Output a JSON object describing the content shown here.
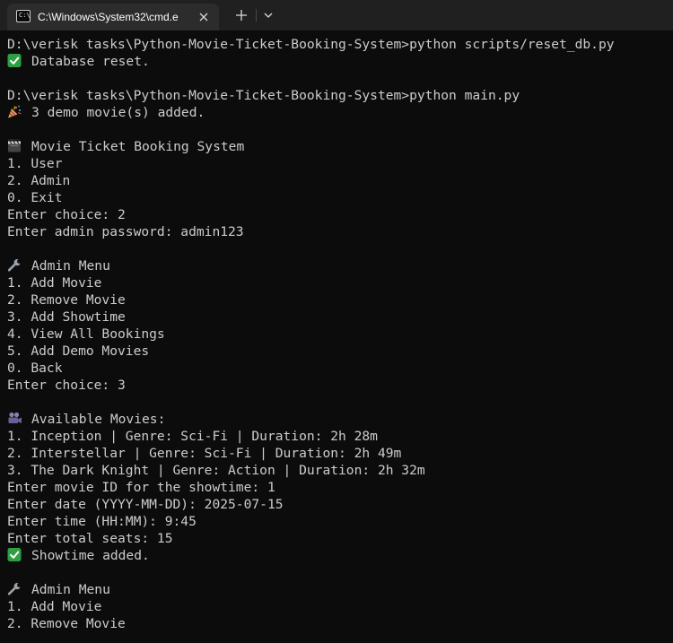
{
  "window": {
    "tab_title": "C:\\Windows\\System32\\cmd.e",
    "tab_icon": "cmd-prompt-icon",
    "new_tab_icon": "plus-icon",
    "dropdown_icon": "chevron-down-icon",
    "close_icon": "close-icon"
  },
  "colors": {
    "background": "#0c0c0c",
    "text": "#cccccc",
    "titlebar": "#202020",
    "tab": "#2c2c2c",
    "check_green": "#2ea043"
  },
  "terminal": {
    "lines": [
      {
        "text": "D:\\verisk tasks\\Python-Movie-Ticket-Booking-System>python scripts/reset_db.py"
      },
      {
        "icon": "check-mark-icon",
        "text": "Database reset."
      },
      {
        "text": ""
      },
      {
        "text": "D:\\verisk tasks\\Python-Movie-Ticket-Booking-System>python main.py"
      },
      {
        "icon": "party-popper-icon",
        "text": "3 demo movie(s) added."
      },
      {
        "text": ""
      },
      {
        "icon": "clapperboard-icon",
        "text": "Movie Ticket Booking System"
      },
      {
        "text": "1. User"
      },
      {
        "text": "2. Admin"
      },
      {
        "text": "0. Exit"
      },
      {
        "text": "Enter choice: 2"
      },
      {
        "text": "Enter admin password: admin123"
      },
      {
        "text": ""
      },
      {
        "icon": "wrench-icon",
        "text": "Admin Menu"
      },
      {
        "text": "1. Add Movie"
      },
      {
        "text": "2. Remove Movie"
      },
      {
        "text": "3. Add Showtime"
      },
      {
        "text": "4. View All Bookings"
      },
      {
        "text": "5. Add Demo Movies"
      },
      {
        "text": "0. Back"
      },
      {
        "text": "Enter choice: 3"
      },
      {
        "text": ""
      },
      {
        "icon": "movie-camera-icon",
        "text": "Available Movies:"
      },
      {
        "text": "1. Inception | Genre: Sci-Fi | Duration: 2h 28m"
      },
      {
        "text": "2. Interstellar | Genre: Sci-Fi | Duration: 2h 49m"
      },
      {
        "text": "3. The Dark Knight | Genre: Action | Duration: 2h 32m"
      },
      {
        "text": "Enter movie ID for the showtime: 1"
      },
      {
        "text": "Enter date (YYYY-MM-DD): 2025-07-15"
      },
      {
        "text": "Enter time (HH:MM): 9:45"
      },
      {
        "text": "Enter total seats: 15"
      },
      {
        "icon": "check-mark-icon",
        "text": "Showtime added."
      },
      {
        "text": ""
      },
      {
        "icon": "wrench-icon",
        "text": "Admin Menu"
      },
      {
        "text": "1. Add Movie"
      },
      {
        "text": "2. Remove Movie"
      }
    ]
  }
}
